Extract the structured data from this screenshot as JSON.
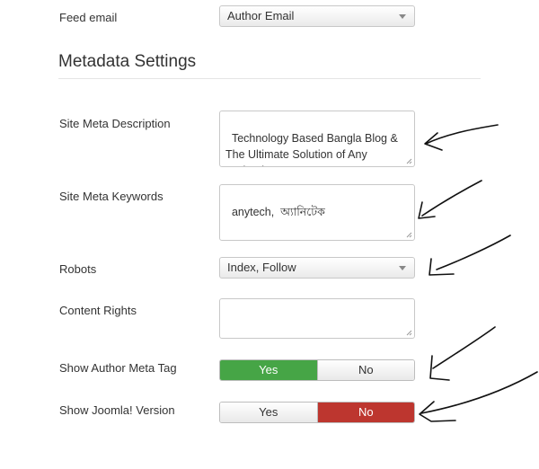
{
  "feed_email": {
    "label": "Feed email",
    "value": "Author Email"
  },
  "section": {
    "title": "Metadata Settings"
  },
  "site_meta_description": {
    "label": "Site Meta Description",
    "value": "Technology Based Bangla Blog & The Ultimate Solution of Any Technology"
  },
  "site_meta_keywords": {
    "label": "Site Meta Keywords",
    "value": "anytech,  অ্যানিটেক"
  },
  "robots": {
    "label": "Robots",
    "value": "Index, Follow"
  },
  "content_rights": {
    "label": "Content Rights",
    "value": ""
  },
  "show_author_meta_tag": {
    "label": "Show Author Meta Tag",
    "yes": "Yes",
    "no": "No",
    "selected": "Yes"
  },
  "show_joomla_version": {
    "label": "Show Joomla! Version",
    "yes": "Yes",
    "no": "No",
    "selected": "No"
  },
  "colors": {
    "yes_active": "#46a546",
    "no_active": "#bd362f"
  }
}
